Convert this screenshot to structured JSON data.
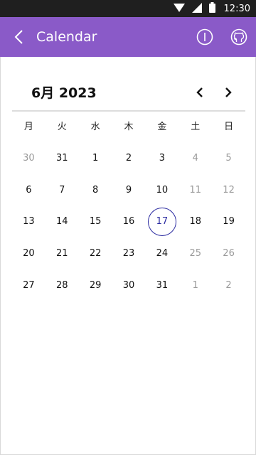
{
  "status_bar": {
    "time": "12:30",
    "icons": [
      "wifi-icon",
      "signal-icon",
      "battery-icon"
    ]
  },
  "app_bar": {
    "title": "Calendar",
    "color": "#8a5ac8",
    "actions": [
      "info-icon",
      "github-icon"
    ]
  },
  "calendar": {
    "month_label": "6月 2023",
    "weekdays": [
      "月",
      "火",
      "水",
      "木",
      "金",
      "土",
      "日"
    ],
    "selected_color": "#2a2aa0",
    "days": [
      {
        "label": "30",
        "other": true
      },
      {
        "label": "31",
        "other": false
      },
      {
        "label": "1",
        "other": false
      },
      {
        "label": "2",
        "other": false
      },
      {
        "label": "3",
        "other": false
      },
      {
        "label": "4",
        "other": true
      },
      {
        "label": "5",
        "other": true
      },
      {
        "label": "6",
        "other": false
      },
      {
        "label": "7",
        "other": false
      },
      {
        "label": "8",
        "other": false
      },
      {
        "label": "9",
        "other": false
      },
      {
        "label": "10",
        "other": false
      },
      {
        "label": "11",
        "other": true
      },
      {
        "label": "12",
        "other": true
      },
      {
        "label": "13",
        "other": false
      },
      {
        "label": "14",
        "other": false
      },
      {
        "label": "15",
        "other": false
      },
      {
        "label": "16",
        "other": false
      },
      {
        "label": "17",
        "other": false,
        "selected": true
      },
      {
        "label": "18",
        "other": false
      },
      {
        "label": "19",
        "other": false
      },
      {
        "label": "20",
        "other": false
      },
      {
        "label": "21",
        "other": false
      },
      {
        "label": "22",
        "other": false
      },
      {
        "label": "23",
        "other": false
      },
      {
        "label": "24",
        "other": false
      },
      {
        "label": "25",
        "other": true
      },
      {
        "label": "26",
        "other": true
      },
      {
        "label": "27",
        "other": false
      },
      {
        "label": "28",
        "other": false
      },
      {
        "label": "29",
        "other": false
      },
      {
        "label": "30",
        "other": false
      },
      {
        "label": "31",
        "other": false
      },
      {
        "label": "1",
        "other": true
      },
      {
        "label": "2",
        "other": true
      }
    ]
  }
}
